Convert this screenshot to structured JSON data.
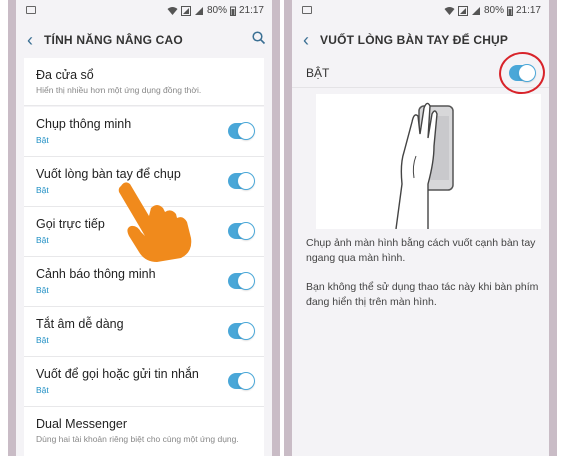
{
  "status": {
    "battery": "80%",
    "time": "21:17"
  },
  "left": {
    "title": "TÍNH NĂNG NÂNG CAO",
    "items": [
      {
        "label": "Đa cửa sổ",
        "desc": "Hiển thị nhiều hơn một ứng dụng đồng thời."
      },
      {
        "label": "Chụp thông minh",
        "sub": "Bật"
      },
      {
        "label": "Vuốt lòng bàn tay để chụp",
        "sub": "Bật"
      },
      {
        "label": "Gọi trực tiếp",
        "sub": "Bật"
      },
      {
        "label": "Cảnh báo thông minh",
        "sub": "Bật"
      },
      {
        "label": "Tắt âm dễ dàng",
        "sub": "Bật"
      },
      {
        "label": "Vuốt để gọi hoặc gửi tin nhắn",
        "sub": "Bật"
      },
      {
        "label": "Dual Messenger",
        "desc": "Dùng hai tài khoản riêng biệt cho cùng một ứng dụng."
      }
    ]
  },
  "right": {
    "title": "VUỐT LÒNG BÀN TAY ĐỂ CHỤP",
    "on_label": "BẬT",
    "desc1": "Chụp ảnh màn hình bằng cách vuốt cạnh bàn tay ngang qua màn hình.",
    "desc2": "Bạn không thể sử dụng thao tác này khi bàn phím đang hiển thị trên màn hình."
  },
  "colors": {
    "accent": "#4aa7d8",
    "sub_text": "#1f8fc4",
    "annotation": "#d8232a",
    "hand": "#f08a1c",
    "frame": "#c9bcc6"
  },
  "icons": [
    "back-arrow-icon",
    "search-icon",
    "image-icon",
    "wifi-icon",
    "signal-icon",
    "battery-icon",
    "hand-pointer-icon",
    "palm-swipe-illustration"
  ]
}
